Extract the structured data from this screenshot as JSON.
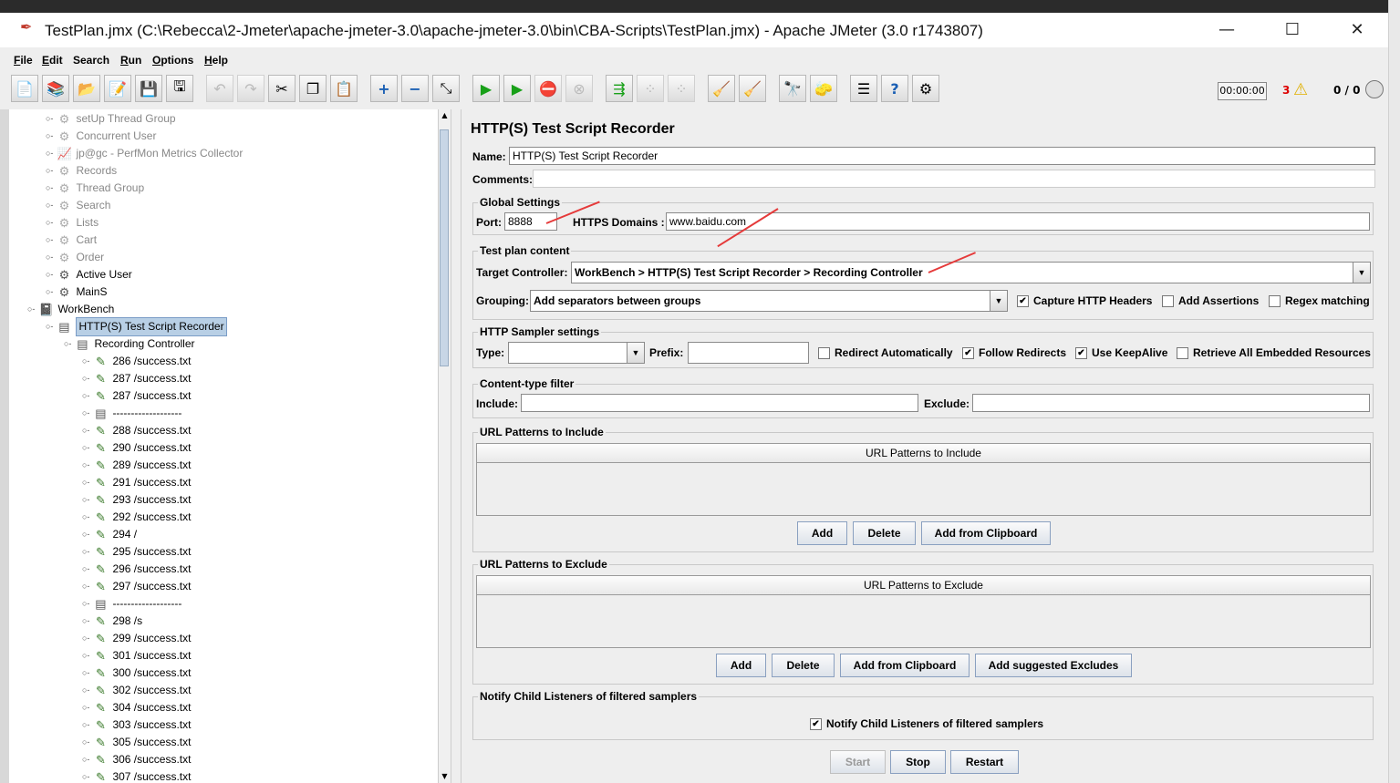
{
  "window": {
    "title": "TestPlan.jmx (C:\\Rebecca\\2-Jmeter\\apache-jmeter-3.0\\apache-jmeter-3.0\\bin\\CBA-Scripts\\TestPlan.jmx) - Apache JMeter (3.0 r1743807)"
  },
  "menu": [
    {
      "accel": "F",
      "rest": "ile"
    },
    {
      "accel": "E",
      "rest": "dit"
    },
    {
      "accel": "",
      "rest": "Search"
    },
    {
      "accel": "R",
      "rest": "un"
    },
    {
      "accel": "O",
      "rest": "ptions"
    },
    {
      "accel": "H",
      "rest": "elp"
    }
  ],
  "status": {
    "timer": "00:00:00",
    "error_count": "3",
    "threads": "0 / 0"
  },
  "tree": {
    "items": [
      {
        "label": "setUp Thread Group",
        "icon": "gear-icon",
        "disabled": true
      },
      {
        "label": "Concurrent User",
        "icon": "gear-icon",
        "disabled": true
      },
      {
        "label": "jp@gc - PerfMon Metrics Collector",
        "icon": "chart-icon",
        "disabled": true
      },
      {
        "label": "Records",
        "icon": "gear-icon",
        "disabled": true
      },
      {
        "label": "Thread Group",
        "icon": "gear-icon",
        "disabled": true
      },
      {
        "label": "Search",
        "icon": "gear-icon",
        "disabled": true
      },
      {
        "label": "Lists",
        "icon": "gear-icon",
        "disabled": true
      },
      {
        "label": "Cart",
        "icon": "gear-icon",
        "disabled": true
      },
      {
        "label": "Order",
        "icon": "gear-icon",
        "disabled": true
      },
      {
        "label": "Active User",
        "icon": "gear-icon",
        "disabled": false
      },
      {
        "label": "MainS",
        "icon": "gear-icon",
        "disabled": false
      },
      {
        "label": "WorkBench",
        "icon": "workbench-icon",
        "disabled": false
      },
      {
        "label": "HTTP(S) Test Script Recorder",
        "icon": "recorder-icon",
        "disabled": false,
        "selected": true
      },
      {
        "label": "Recording Controller",
        "icon": "controller-icon",
        "disabled": false
      },
      {
        "label": "286 /success.txt",
        "icon": "sampler-icon"
      },
      {
        "label": "287 /success.txt",
        "icon": "sampler-icon"
      },
      {
        "label": "287 /success.txt",
        "icon": "sampler-icon"
      },
      {
        "label": "-------------------",
        "icon": "controller-icon"
      },
      {
        "label": "288 /success.txt",
        "icon": "sampler-icon"
      },
      {
        "label": "290 /success.txt",
        "icon": "sampler-icon"
      },
      {
        "label": "289 /success.txt",
        "icon": "sampler-icon"
      },
      {
        "label": "291 /success.txt",
        "icon": "sampler-icon"
      },
      {
        "label": "293 /success.txt",
        "icon": "sampler-icon"
      },
      {
        "label": "292 /success.txt",
        "icon": "sampler-icon"
      },
      {
        "label": "294 /",
        "icon": "sampler-icon"
      },
      {
        "label": "295 /success.txt",
        "icon": "sampler-icon"
      },
      {
        "label": "296 /success.txt",
        "icon": "sampler-icon"
      },
      {
        "label": "297 /success.txt",
        "icon": "sampler-icon"
      },
      {
        "label": "-------------------",
        "icon": "controller-icon"
      },
      {
        "label": "298 /s",
        "icon": "sampler-icon"
      },
      {
        "label": "299 /success.txt",
        "icon": "sampler-icon"
      },
      {
        "label": "301 /success.txt",
        "icon": "sampler-icon"
      },
      {
        "label": "300 /success.txt",
        "icon": "sampler-icon"
      },
      {
        "label": "302 /success.txt",
        "icon": "sampler-icon"
      },
      {
        "label": "304 /success.txt",
        "icon": "sampler-icon"
      },
      {
        "label": "303 /success.txt",
        "icon": "sampler-icon"
      },
      {
        "label": "305 /success.txt",
        "icon": "sampler-icon"
      },
      {
        "label": "306 /success.txt",
        "icon": "sampler-icon"
      },
      {
        "label": "307 /success.txt",
        "icon": "sampler-icon"
      }
    ]
  },
  "panel": {
    "title": "HTTP(S) Test Script Recorder",
    "name_label": "Name:",
    "name_value": "HTTP(S) Test Script Recorder",
    "comments_label": "Comments:",
    "global": {
      "legend": "Global Settings",
      "port_label": "Port:",
      "port_value": "8888",
      "https_label": "HTTPS Domains :",
      "https_value": "www.baidu.com"
    },
    "plan": {
      "legend": "Test plan content",
      "target_label": "Target Controller:",
      "target_value": "WorkBench > HTTP(S) Test Script Recorder > Recording Controller",
      "grouping_label": "Grouping:",
      "grouping_value": "Add separators between groups",
      "capture_headers": {
        "label": "Capture HTTP Headers",
        "checked": true
      },
      "add_assertions": {
        "label": "Add Assertions",
        "checked": false
      },
      "regex_matching": {
        "label": "Regex matching",
        "checked": false
      }
    },
    "sampler": {
      "legend": "HTTP Sampler settings",
      "type_label": "Type:",
      "type_value": "",
      "prefix_label": "Prefix:",
      "prefix_value": "",
      "redirect_auto": {
        "label": "Redirect Automatically",
        "checked": false
      },
      "follow_redirects": {
        "label": "Follow Redirects",
        "checked": true
      },
      "keepalive": {
        "label": "Use KeepAlive",
        "checked": true
      },
      "retrieve_all": {
        "label": "Retrieve All Embedded Resources",
        "checked": false
      }
    },
    "content_type": {
      "legend": "Content-type filter",
      "include_label": "Include:",
      "include_value": "",
      "exclude_label": "Exclude:",
      "exclude_value": ""
    },
    "url_include": {
      "legend": "URL Patterns to Include",
      "header": "URL Patterns to Include",
      "add": "Add",
      "delete": "Delete",
      "add_clipboard": "Add from Clipboard"
    },
    "url_exclude": {
      "legend": "URL Patterns to Exclude",
      "header": "URL Patterns to Exclude",
      "add": "Add",
      "delete": "Delete",
      "add_clipboard": "Add from Clipboard",
      "add_suggested": "Add suggested Excludes"
    },
    "notify": {
      "legend": "Notify Child Listeners of filtered samplers",
      "checkbox_label": "Notify Child Listeners of filtered samplers",
      "checked": true
    },
    "actions": {
      "start": "Start",
      "stop": "Stop",
      "restart": "Restart"
    }
  },
  "colors": {
    "annotation_arrow": "#e53a3a",
    "selection": "#b8cfe5"
  }
}
